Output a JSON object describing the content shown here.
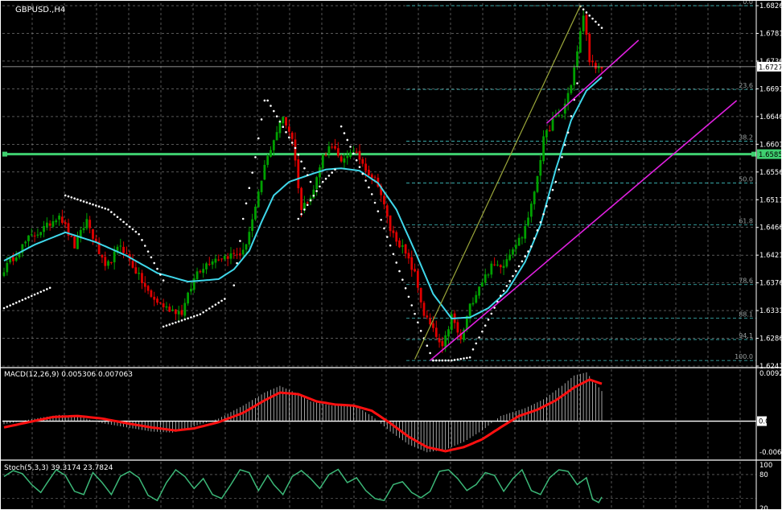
{
  "window": {
    "symbol_label": "GBPUSD.,H4"
  },
  "colors": {
    "background": "#000000",
    "grid": "#8c8c8c",
    "bull_candle": "#00a000",
    "bear_candle": "#e00000",
    "moving_average": "#3fd7ea",
    "parabolic_sar": "#ffffff",
    "trendlines": "#e020e0",
    "fib_lines": "#3fbfbf",
    "channel_line": "#9aa63a",
    "support_line": "#3fd070",
    "macd_signal": "#ff1010",
    "macd_histogram": "#c8c8c8",
    "stoch_main": "#3cb878",
    "price_tag_bg": "#ffffff",
    "support_tag_bg": "#3fd070"
  },
  "chart_data": [
    {
      "type": "candlestick",
      "panel": "main",
      "title": "GBPUSD.,H4",
      "ylim": [
        1.6241,
        1.683
      ],
      "y_ticks": [
        "1.6826",
        "1.6781",
        "1.6736",
        "1.6691",
        "1.6646",
        "1.6601",
        "1.6556",
        "1.6511",
        "1.6466",
        "1.6421",
        "1.6376",
        "1.6331",
        "1.6286",
        "1.6241"
      ],
      "current_price": 1.6727,
      "current_price_label": "1.6727",
      "horizontal_line_price": 1.6585,
      "horizontal_line_label": "1.6585",
      "fibonacci": {
        "high": 1.6826,
        "low": 1.625,
        "levels": [
          {
            "label": "0.0",
            "ratio": 0.0
          },
          {
            "label": "23.6",
            "ratio": 0.236
          },
          {
            "label": "38.2",
            "ratio": 0.382
          },
          {
            "label": "50.0",
            "ratio": 0.5
          },
          {
            "label": "61.8",
            "ratio": 0.618
          },
          {
            "label": "78.6",
            "ratio": 0.786
          },
          {
            "label": "88.1",
            "ratio": 0.881
          },
          {
            "label": "94.1",
            "ratio": 0.941
          },
          {
            "label": "100.0",
            "ratio": 1.0
          }
        ]
      },
      "close_anchors": [
        [
          0,
          1.6398
        ],
        [
          8,
          1.6448
        ],
        [
          14,
          1.6468
        ],
        [
          18,
          1.6488
        ],
        [
          23,
          1.6435
        ],
        [
          27,
          1.6478
        ],
        [
          33,
          1.6398
        ],
        [
          38,
          1.6438
        ],
        [
          43,
          1.6395
        ],
        [
          48,
          1.6352
        ],
        [
          53,
          1.6335
        ],
        [
          58,
          1.6328
        ],
        [
          63,
          1.6395
        ],
        [
          68,
          1.6415
        ],
        [
          73,
          1.642
        ],
        [
          78,
          1.6425
        ],
        [
          82,
          1.6495
        ],
        [
          85,
          1.6565
        ],
        [
          88,
          1.661
        ],
        [
          91,
          1.6645
        ],
        [
          94,
          1.6612
        ],
        [
          97,
          1.6495
        ],
        [
          101,
          1.6528
        ],
        [
          104,
          1.6582
        ],
        [
          107,
          1.6602
        ],
        [
          110,
          1.6568
        ],
        [
          113,
          1.6592
        ],
        [
          116,
          1.6578
        ],
        [
          119,
          1.6555
        ],
        [
          122,
          1.6538
        ],
        [
          126,
          1.6462
        ],
        [
          130,
          1.6432
        ],
        [
          134,
          1.639
        ],
        [
          137,
          1.6325
        ],
        [
          140,
          1.6298
        ],
        [
          143,
          1.6268
        ],
        [
          146,
          1.6322
        ],
        [
          149,
          1.6282
        ],
        [
          152,
          1.6338
        ],
        [
          155,
          1.6372
        ],
        [
          159,
          1.6402
        ],
        [
          163,
          1.6408
        ],
        [
          166,
          1.6435
        ],
        [
          169,
          1.6452
        ],
        [
          172,
          1.65
        ],
        [
          174,
          1.6552
        ],
        [
          176,
          1.6608
        ],
        [
          179,
          1.664
        ],
        [
          182,
          1.665
        ],
        [
          185,
          1.67
        ],
        [
          187,
          1.675
        ],
        [
          189,
          1.6812
        ],
        [
          191,
          1.674
        ],
        [
          193,
          1.672
        ],
        [
          195,
          1.6725
        ]
      ],
      "moving_average_anchors": [
        [
          0,
          1.6412
        ],
        [
          10,
          1.6438
        ],
        [
          20,
          1.6458
        ],
        [
          30,
          1.6442
        ],
        [
          40,
          1.642
        ],
        [
          50,
          1.6392
        ],
        [
          60,
          1.6378
        ],
        [
          70,
          1.6382
        ],
        [
          75,
          1.6398
        ],
        [
          80,
          1.6428
        ],
        [
          84,
          1.6475
        ],
        [
          88,
          1.6518
        ],
        [
          93,
          1.654
        ],
        [
          100,
          1.6552
        ],
        [
          105,
          1.656
        ],
        [
          110,
          1.6562
        ],
        [
          116,
          1.6558
        ],
        [
          122,
          1.6538
        ],
        [
          128,
          1.6495
        ],
        [
          134,
          1.6428
        ],
        [
          140,
          1.6358
        ],
        [
          146,
          1.6318
        ],
        [
          152,
          1.632
        ],
        [
          158,
          1.6335
        ],
        [
          164,
          1.6362
        ],
        [
          170,
          1.641
        ],
        [
          175,
          1.647
        ],
        [
          180,
          1.656
        ],
        [
          185,
          1.664
        ],
        [
          190,
          1.6688
        ],
        [
          195,
          1.671
        ]
      ],
      "parabolic_sar_segments": [
        [
          [
            0,
            1.6335
          ],
          [
            15,
            1.6368
          ]
        ],
        [
          [
            20,
            1.6518
          ],
          [
            34,
            1.6495
          ],
          [
            44,
            1.6455
          ],
          [
            52,
            1.638
          ]
        ],
        [
          [
            52,
            1.6305
          ],
          [
            64,
            1.6325
          ],
          [
            72,
            1.635
          ]
        ],
        [
          [
            75,
            1.6372
          ],
          [
            78,
            1.648
          ],
          [
            82,
            1.658
          ],
          [
            85,
            1.6672
          ]
        ],
        [
          [
            86,
            1.6672
          ],
          [
            95,
            1.6595
          ],
          [
            100,
            1.654
          ]
        ],
        [
          [
            96,
            1.648
          ],
          [
            104,
            1.654
          ],
          [
            108,
            1.656
          ]
        ],
        [
          [
            110,
            1.663
          ],
          [
            120,
            1.652
          ],
          [
            129,
            1.6395
          ],
          [
            136,
            1.6298
          ],
          [
            140,
            1.625
          ]
        ],
        [
          [
            140,
            1.625
          ],
          [
            146,
            1.625
          ],
          [
            152,
            1.6255
          ]
        ],
        [
          [
            153,
            1.6268
          ],
          [
            162,
            1.6355
          ],
          [
            172,
            1.6435
          ],
          [
            180,
            1.654
          ],
          [
            184,
            1.662
          ],
          [
            187,
            1.67
          ]
        ],
        [
          [
            188,
            1.6825
          ],
          [
            195,
            1.679
          ]
        ]
      ],
      "trendlines": [
        {
          "kind": "support_upper",
          "from": [
            177,
            1.6635
          ],
          "to": [
            207,
            1.677
          ]
        },
        {
          "kind": "support_lower",
          "from": [
            139,
            1.625
          ],
          "to": [
            239,
            1.6672
          ]
        },
        {
          "kind": "channel",
          "from": [
            134,
            1.6252
          ],
          "to": [
            188,
            1.6826
          ]
        }
      ]
    },
    {
      "type": "bar_line",
      "panel": "macd",
      "title": "MACD(12,26,9) 0.005306 0.007063",
      "ylim": [
        -0.0072,
        0.01
      ],
      "y_ticks": [
        "0.00928",
        "0.00",
        "-0.0069"
      ],
      "zero_label": "0.00",
      "macd_anchors": [
        [
          0,
          -0.0006
        ],
        [
          10,
          0.0005
        ],
        [
          18,
          0.0012
        ],
        [
          25,
          0.0008
        ],
        [
          32,
          -0.0004
        ],
        [
          40,
          -0.0012
        ],
        [
          48,
          -0.002
        ],
        [
          55,
          -0.0022
        ],
        [
          62,
          -0.001
        ],
        [
          70,
          0.0005
        ],
        [
          78,
          0.003
        ],
        [
          85,
          0.0055
        ],
        [
          90,
          0.0068
        ],
        [
          95,
          0.0055
        ],
        [
          100,
          0.0038
        ],
        [
          107,
          0.003
        ],
        [
          114,
          0.0032
        ],
        [
          120,
          0.001
        ],
        [
          126,
          -0.002
        ],
        [
          132,
          -0.0045
        ],
        [
          138,
          -0.006
        ],
        [
          144,
          -0.0055
        ],
        [
          150,
          -0.004
        ],
        [
          156,
          -0.0018
        ],
        [
          162,
          0.001
        ],
        [
          170,
          0.0025
        ],
        [
          176,
          0.0042
        ],
        [
          182,
          0.0068
        ],
        [
          186,
          0.0088
        ],
        [
          190,
          0.0094
        ],
        [
          195,
          0.0058
        ]
      ],
      "signal_anchors": [
        [
          0,
          -0.0012
        ],
        [
          8,
          -0.0002
        ],
        [
          16,
          0.0008
        ],
        [
          24,
          0.001
        ],
        [
          32,
          0.0005
        ],
        [
          40,
          -0.0004
        ],
        [
          48,
          -0.0012
        ],
        [
          56,
          -0.0018
        ],
        [
          62,
          -0.0014
        ],
        [
          70,
          -0.0002
        ],
        [
          78,
          0.0016
        ],
        [
          85,
          0.004
        ],
        [
          90,
          0.0055
        ],
        [
          96,
          0.0052
        ],
        [
          102,
          0.0038
        ],
        [
          108,
          0.0032
        ],
        [
          114,
          0.003
        ],
        [
          120,
          0.002
        ],
        [
          126,
          -0.0004
        ],
        [
          132,
          -0.003
        ],
        [
          138,
          -0.005
        ],
        [
          144,
          -0.0058
        ],
        [
          150,
          -0.005
        ],
        [
          156,
          -0.0035
        ],
        [
          162,
          -0.0012
        ],
        [
          168,
          0.001
        ],
        [
          174,
          0.0022
        ],
        [
          180,
          0.004
        ],
        [
          186,
          0.0065
        ],
        [
          191,
          0.008
        ],
        [
          195,
          0.0072
        ]
      ]
    },
    {
      "type": "line",
      "panel": "stochastic",
      "title": "Stoch(5,3,3) 39.3174 23.7824",
      "ylim": [
        0,
        100
      ],
      "y_ticks": [
        "100",
        "80",
        "20"
      ],
      "stoch_anchors": [
        [
          0,
          75
        ],
        [
          3,
          90
        ],
        [
          6,
          82
        ],
        [
          9,
          55
        ],
        [
          12,
          35
        ],
        [
          15,
          70
        ],
        [
          17,
          92
        ],
        [
          20,
          78
        ],
        [
          23,
          38
        ],
        [
          26,
          30
        ],
        [
          29,
          85
        ],
        [
          32,
          60
        ],
        [
          35,
          30
        ],
        [
          38,
          76
        ],
        [
          41,
          88
        ],
        [
          44,
          72
        ],
        [
          47,
          28
        ],
        [
          50,
          15
        ],
        [
          53,
          60
        ],
        [
          56,
          92
        ],
        [
          59,
          75
        ],
        [
          62,
          45
        ],
        [
          65,
          70
        ],
        [
          68,
          30
        ],
        [
          71,
          20
        ],
        [
          74,
          55
        ],
        [
          77,
          92
        ],
        [
          80,
          85
        ],
        [
          83,
          40
        ],
        [
          86,
          78
        ],
        [
          88,
          55
        ],
        [
          91,
          30
        ],
        [
          94,
          75
        ],
        [
          97,
          90
        ],
        [
          100,
          70
        ],
        [
          103,
          45
        ],
        [
          106,
          80
        ],
        [
          109,
          93
        ],
        [
          112,
          60
        ],
        [
          115,
          72
        ],
        [
          118,
          40
        ],
        [
          121,
          20
        ],
        [
          124,
          15
        ],
        [
          127,
          55
        ],
        [
          130,
          62
        ],
        [
          133,
          35
        ],
        [
          136,
          22
        ],
        [
          139,
          38
        ],
        [
          142,
          88
        ],
        [
          145,
          92
        ],
        [
          148,
          70
        ],
        [
          151,
          40
        ],
        [
          154,
          55
        ],
        [
          157,
          85
        ],
        [
          160,
          78
        ],
        [
          163,
          38
        ],
        [
          166,
          70
        ],
        [
          169,
          92
        ],
        [
          172,
          40
        ],
        [
          175,
          30
        ],
        [
          178,
          72
        ],
        [
          181,
          92
        ],
        [
          184,
          88
        ],
        [
          187,
          55
        ],
        [
          190,
          72
        ],
        [
          192,
          18
        ],
        [
          194,
          10
        ],
        [
          195,
          24
        ]
      ]
    }
  ]
}
